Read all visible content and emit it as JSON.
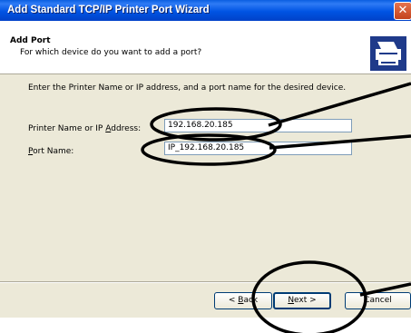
{
  "window": {
    "title": "Add Standard TCP/IP Printer Port Wizard",
    "close_glyph": "✕"
  },
  "header": {
    "title": "Add Port",
    "subtitle": "For which device do you want to add a port?",
    "icon": "printer-icon"
  },
  "body": {
    "instructions": "Enter the Printer Name or IP address, and a port name for the desired device."
  },
  "form": {
    "printer_label_pre": "Printer Name or IP ",
    "printer_label_key": "A",
    "printer_label_post": "ddress:",
    "printer_value": "192.168.20.185",
    "port_label_key": "P",
    "port_label_post": "ort Name:",
    "port_value": "IP_192.168.20.185"
  },
  "buttons": {
    "back_pre": "< ",
    "back_key": "B",
    "back_post": "ack",
    "next_key": "N",
    "next_post": "ext >",
    "cancel": "Cancel"
  },
  "colors": {
    "titlebar": "#0054e3",
    "dialog_bg": "#ece9d8",
    "annotation": "#000000"
  }
}
